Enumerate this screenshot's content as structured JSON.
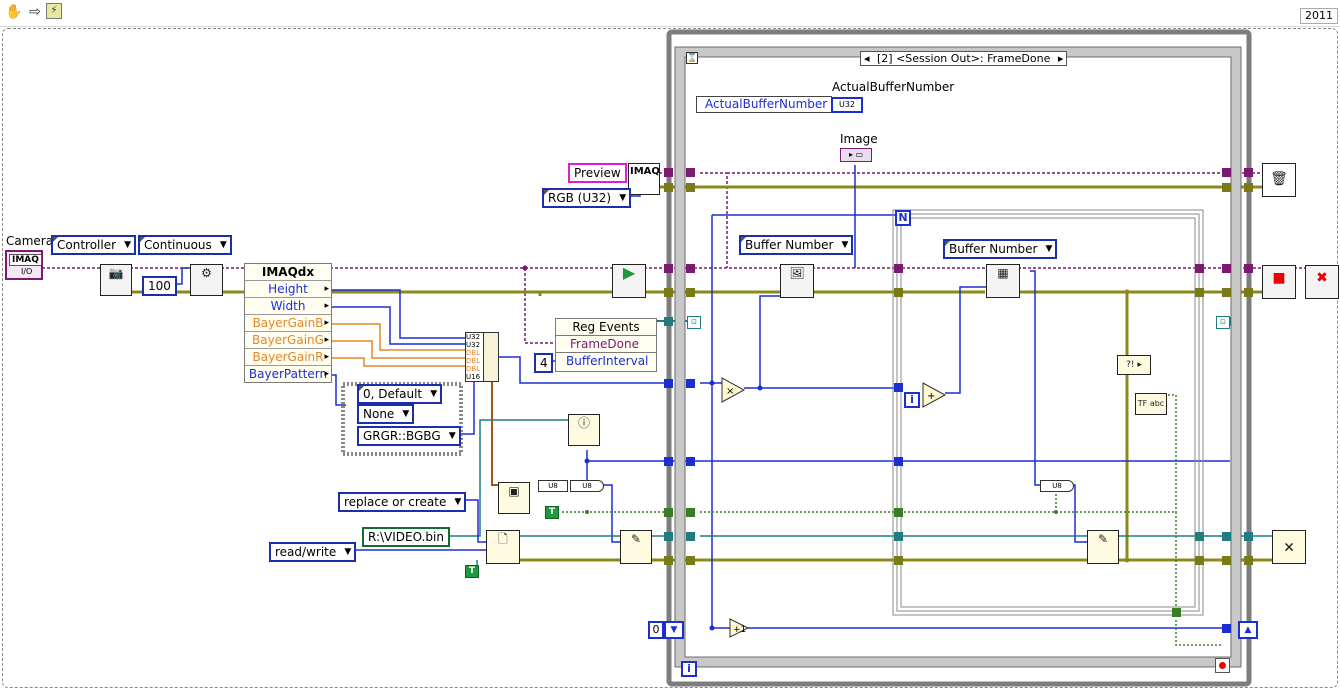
{
  "toolbar": {
    "version": "2011"
  },
  "camera": {
    "label": "Camera",
    "terminal_text": "IMAQ",
    "terminal_sub": "I/O"
  },
  "constants": {
    "controller": "Controller",
    "continuous": "Continuous",
    "hundred": "100",
    "rgb": "RGB (U32)",
    "buffer_number_1": "Buffer Number",
    "buffer_number_2": "Buffer Number",
    "default_ring": "0, Default",
    "none": "None",
    "grgr": "GRGR::BGBG",
    "four": "4",
    "replace_or_create": "replace or create",
    "file_path": "R:\\VIDEO.bin",
    "read_write": "read/write",
    "zero": "0",
    "true_text": "T"
  },
  "preview": {
    "label": "Preview",
    "imaq_text": "IMAQ"
  },
  "indicators": {
    "actual_buffer_label": "ActualBufferNumber",
    "actual_buffer_local": "ActualBufferNumber",
    "actual_buffer_type": "U32",
    "image_label": "Image"
  },
  "property_node": {
    "class": "IMAQdx",
    "items": [
      {
        "name": "Height",
        "color": "#1b2fd1"
      },
      {
        "name": "Width",
        "color": "#1b2fd1"
      },
      {
        "name": "BayerGainB",
        "color": "#e4872a"
      },
      {
        "name": "BayerGainG",
        "color": "#e4872a"
      },
      {
        "name": "BayerGainR",
        "color": "#e4872a"
      },
      {
        "name": "BayerPattern",
        "color": "#1b2fd1"
      }
    ]
  },
  "bundle_types": [
    "U32",
    "U32",
    "DBL",
    "DBL",
    "DBL",
    "U16"
  ],
  "reg_events": {
    "title": "Reg Events",
    "event": "FrameDone",
    "param": "BufferInterval"
  },
  "event_structure": {
    "case": "[2] <Session Out>: FrameDone"
  },
  "loop": {
    "count_terminal": "N",
    "iteration": "i",
    "outer_iteration": "i"
  },
  "types": {
    "u8": "U8",
    "u8_2": "U8",
    "u8_3": "U8"
  },
  "colors": {
    "wire_purple": "#7b1a6e",
    "wire_olive": "#8a8a1a",
    "wire_blue": "#1b2fd1",
    "wire_teal": "#1f7d7d",
    "wire_green": "#3a7d27",
    "wire_orange": "#e4872a",
    "frame_grey": "#7d7d7d"
  }
}
